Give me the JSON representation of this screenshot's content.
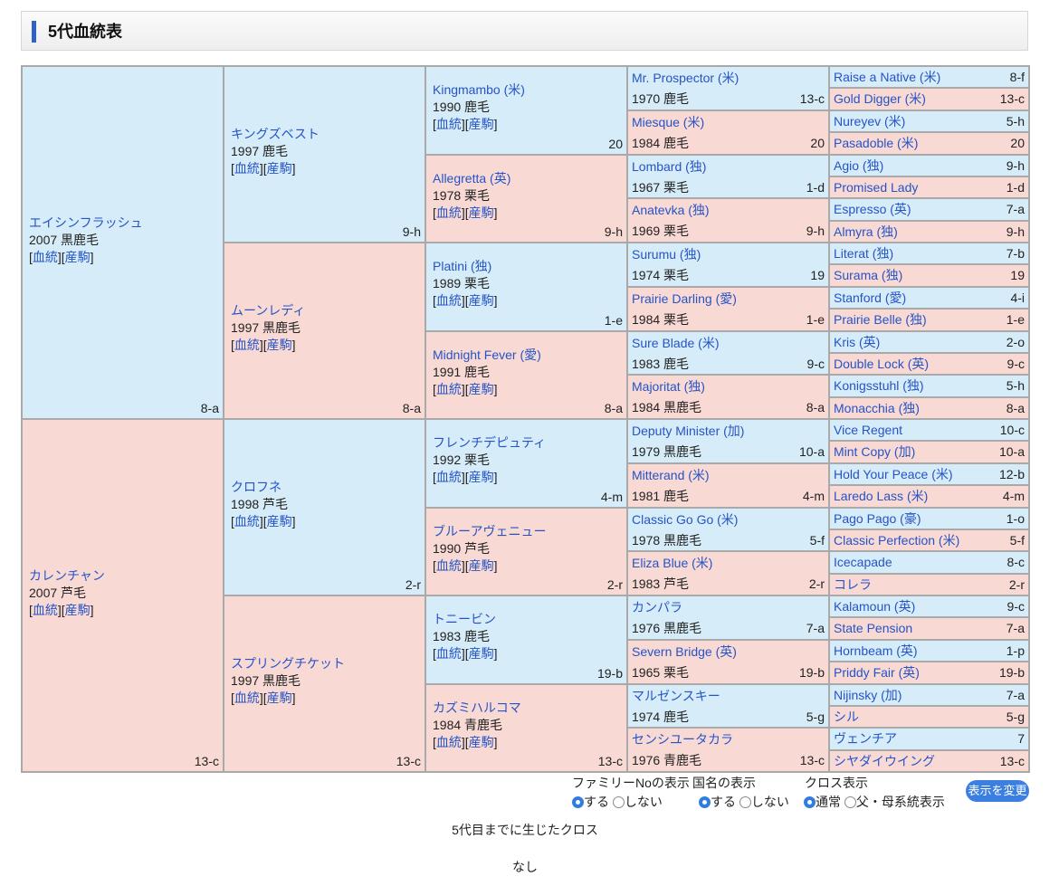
{
  "page": {
    "title": "5代血統表"
  },
  "link_labels": {
    "pedigree": "血統",
    "progeny": "産駒"
  },
  "gen1": [
    {
      "name": "エイシンフラッシュ",
      "year": "2007",
      "color": "黒鹿毛",
      "family": "8-a"
    },
    {
      "name": "カレンチャン",
      "year": "2007",
      "color": "芦毛",
      "family": "13-c"
    }
  ],
  "gen2": [
    {
      "name": "キングズベスト",
      "year": "1997",
      "color": "鹿毛",
      "family": "9-h"
    },
    {
      "name": "ムーンレディ",
      "year": "1997",
      "color": "黒鹿毛",
      "family": "8-a"
    },
    {
      "name": "クロフネ",
      "year": "1998",
      "color": "芦毛",
      "family": "2-r"
    },
    {
      "name": "スプリングチケット",
      "year": "1997",
      "color": "黒鹿毛",
      "family": "13-c"
    }
  ],
  "gen3": [
    {
      "name": "Kingmambo (米)",
      "year": "1990",
      "color": "鹿毛",
      "family": "20"
    },
    {
      "name": "Allegretta (英)",
      "year": "1978",
      "color": "栗毛",
      "family": "9-h"
    },
    {
      "name": "Platini (独)",
      "year": "1989",
      "color": "栗毛",
      "family": "1-e"
    },
    {
      "name": "Midnight Fever (愛)",
      "year": "1991",
      "color": "鹿毛",
      "family": "8-a"
    },
    {
      "name": "フレンチデピュティ",
      "year": "1992",
      "color": "栗毛",
      "family": "4-m"
    },
    {
      "name": "ブルーアヴェニュー",
      "year": "1990",
      "color": "芦毛",
      "family": "2-r"
    },
    {
      "name": "トニービン",
      "year": "1983",
      "color": "鹿毛",
      "family": "19-b"
    },
    {
      "name": "カズミハルコマ",
      "year": "1984",
      "color": "青鹿毛",
      "family": "13-c"
    }
  ],
  "gen4": [
    {
      "name": "Mr. Prospector (米)",
      "info": "1970 鹿毛",
      "family": "13-c"
    },
    {
      "name": "Miesque (米)",
      "info": "1984 鹿毛",
      "family": "20"
    },
    {
      "name": "Lombard (独)",
      "info": "1967 栗毛",
      "family": "1-d"
    },
    {
      "name": "Anatevka (独)",
      "info": "1969 栗毛",
      "family": "9-h"
    },
    {
      "name": "Surumu (独)",
      "info": "1974 栗毛",
      "family": "19"
    },
    {
      "name": "Prairie Darling (愛)",
      "info": "1984 栗毛",
      "family": "1-e"
    },
    {
      "name": "Sure Blade (米)",
      "info": "1983 鹿毛",
      "family": "9-c"
    },
    {
      "name": "Majoritat (独)",
      "info": "1984 黒鹿毛",
      "family": "8-a"
    },
    {
      "name": "Deputy Minister (加)",
      "info": "1979 黒鹿毛",
      "family": "10-a"
    },
    {
      "name": "Mitterand (米)",
      "info": "1981 鹿毛",
      "family": "4-m"
    },
    {
      "name": "Classic Go Go (米)",
      "info": "1978 黒鹿毛",
      "family": "5-f"
    },
    {
      "name": "Eliza Blue (米)",
      "info": "1983 芦毛",
      "family": "2-r"
    },
    {
      "name": "カンパラ",
      "info": "1976 黒鹿毛",
      "family": "7-a"
    },
    {
      "name": "Severn Bridge (英)",
      "info": "1965 栗毛",
      "family": "19-b"
    },
    {
      "name": "マルゼンスキー",
      "info": "1974 鹿毛",
      "family": "5-g"
    },
    {
      "name": "センシユータカラ",
      "info": "1976 青鹿毛",
      "family": "13-c"
    }
  ],
  "gen5": [
    {
      "name": "Raise a Native (米)",
      "family": "8-f"
    },
    {
      "name": "Gold Digger (米)",
      "family": "13-c"
    },
    {
      "name": "Nureyev (米)",
      "family": "5-h"
    },
    {
      "name": "Pasadoble (米)",
      "family": "20"
    },
    {
      "name": "Agio (独)",
      "family": "9-h"
    },
    {
      "name": "Promised Lady",
      "family": "1-d"
    },
    {
      "name": "Espresso (英)",
      "family": "7-a"
    },
    {
      "name": "Almyra (独)",
      "family": "9-h"
    },
    {
      "name": "Literat (独)",
      "family": "7-b"
    },
    {
      "name": "Surama (独)",
      "family": "19"
    },
    {
      "name": "Stanford (愛)",
      "family": "4-i"
    },
    {
      "name": "Prairie Belle (独)",
      "family": "1-e"
    },
    {
      "name": "Kris (英)",
      "family": "2-o"
    },
    {
      "name": "Double Lock (英)",
      "family": "9-c"
    },
    {
      "name": "Konigsstuhl (独)",
      "family": "5-h"
    },
    {
      "name": "Monacchia (独)",
      "family": "8-a"
    },
    {
      "name": "Vice Regent",
      "family": "10-c"
    },
    {
      "name": "Mint Copy (加)",
      "family": "10-a"
    },
    {
      "name": "Hold Your Peace (米)",
      "family": "12-b"
    },
    {
      "name": "Laredo Lass (米)",
      "family": "4-m"
    },
    {
      "name": "Pago Pago (豪)",
      "family": "1-o"
    },
    {
      "name": "Classic Perfection (米)",
      "family": "5-f"
    },
    {
      "name": "Icecapade",
      "family": "8-c"
    },
    {
      "name": "コレラ",
      "family": "2-r"
    },
    {
      "name": "Kalamoun (英)",
      "family": "9-c"
    },
    {
      "name": "State Pension",
      "family": "7-a"
    },
    {
      "name": "Hornbeam (英)",
      "family": "1-p"
    },
    {
      "name": "Priddy Fair (英)",
      "family": "19-b"
    },
    {
      "name": "Nijinsky (加)",
      "family": "7-a"
    },
    {
      "name": "シル",
      "family": "5-g"
    },
    {
      "name": "ヴェンチア",
      "family": "7"
    },
    {
      "name": "シヤダイウイング",
      "family": "13-c"
    }
  ],
  "options": {
    "family_label": "ファミリーNoの表示",
    "country_label": "国名の表示",
    "cross_label": "クロス表示",
    "show": "する",
    "hide": "しない",
    "normal": "通常",
    "parent_line": "父・母系統表示",
    "change_button": "表示を変更"
  },
  "cross": {
    "title": "5代目までに生じたクロス",
    "result": "なし"
  }
}
